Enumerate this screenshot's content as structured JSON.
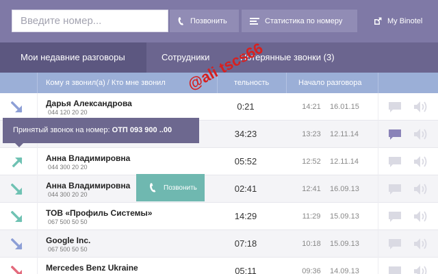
{
  "header": {
    "search_placeholder": "Введите номер...",
    "call_button": "Позвонить",
    "stats_button": "Статистика по номеру",
    "my_binotel": "My Binotel"
  },
  "tabs": [
    {
      "label": "Мои недавние разговоры",
      "active": true
    },
    {
      "label": "Сотрудники",
      "active": false
    },
    {
      "label": "Потерянные звонки (3)",
      "active": false
    }
  ],
  "table": {
    "columns": [
      "Кому я звонил(а) / Кто мне звонил",
      "тельность",
      "Начало разговора"
    ],
    "rows": [
      {
        "name": "Дарья Александрова",
        "phone": "044 120 20 20",
        "duration": "0:21",
        "time": "14:21",
        "date": "16.01.15",
        "direction": "incoming"
      },
      {
        "name": "",
        "phone": "",
        "duration": "34:23",
        "time": "13:23",
        "date": "12.11.14",
        "direction": "incoming"
      },
      {
        "name": "Анна Владимировна",
        "phone": "044 300 20 20",
        "duration": "05:52",
        "time": "12:52",
        "date": "12.11.14",
        "direction": "outgoing"
      },
      {
        "name": "Анна Владимировна",
        "phone": "044 300 20 20",
        "duration": "02:41",
        "time": "12:41",
        "date": "16.09.13",
        "direction": "incoming-teal"
      },
      {
        "name": "ТОВ «Профиль Системы»",
        "phone": "067 500 50 50",
        "duration": "14:29",
        "time": "11:29",
        "date": "15.09.13",
        "direction": "incoming-teal"
      },
      {
        "name": "Google Inc.",
        "phone": "067 500 50 50",
        "duration": "07:18",
        "time": "10:18",
        "date": "15.09.13",
        "direction": "incoming"
      },
      {
        "name": "Mercedes Benz Ukraine",
        "phone": "",
        "duration": "05:11",
        "time": "09:36",
        "date": "14.09.13",
        "direction": "missed"
      }
    ]
  },
  "tooltip": {
    "prefix": "Принятый звонок на номер:",
    "number": "ОТП 093 900 ..00"
  },
  "call_hover_label": "Позвонить",
  "watermark": "@ali tscs66",
  "colors": {
    "topbar": "#7f79a6",
    "tabs": "#6b658f",
    "header_row": "#9bafd7",
    "arrow_incoming": "#8d9fd6",
    "arrow_teal": "#6fc2b3",
    "arrow_missed": "#e36a7c",
    "call_hover": "#6fb8b0"
  }
}
